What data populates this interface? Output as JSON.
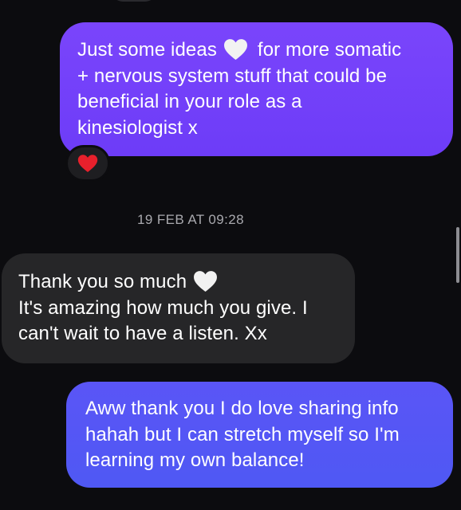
{
  "thread": {
    "outgoing_1": {
      "line_1_before_heart": "Just some ideas",
      "heart_icon": "white-heart-icon",
      "line_1_after_heart": "for more somatic",
      "line_2": "+ nervous system stuff that could be",
      "line_3": "beneficial in your role as a",
      "line_4": "kinesiologist x",
      "reaction": "red-heart-icon"
    },
    "timestamp": "19 FEB AT 09:28",
    "incoming_1": {
      "line_1": "Thank you so much",
      "heart_icon": "white-heart-icon",
      "line_2": "It's amazing how much you give. I",
      "line_3": "can't wait to have a listen. Xx"
    },
    "outgoing_2": {
      "line_1": "Aww thank you I do love sharing info",
      "line_2": "hahah but I can stretch myself so I'm",
      "line_3": "learning my own balance!"
    }
  },
  "colors": {
    "background": "#0c0c0f",
    "outgoing_bubble_1": "#7443fa",
    "outgoing_bubble_2": "#5457f5",
    "incoming_bubble": "#262628",
    "timestamp_text": "#a9a9ae",
    "reaction_heart": "#e8202c",
    "inline_heart": "#f2f2f2"
  }
}
